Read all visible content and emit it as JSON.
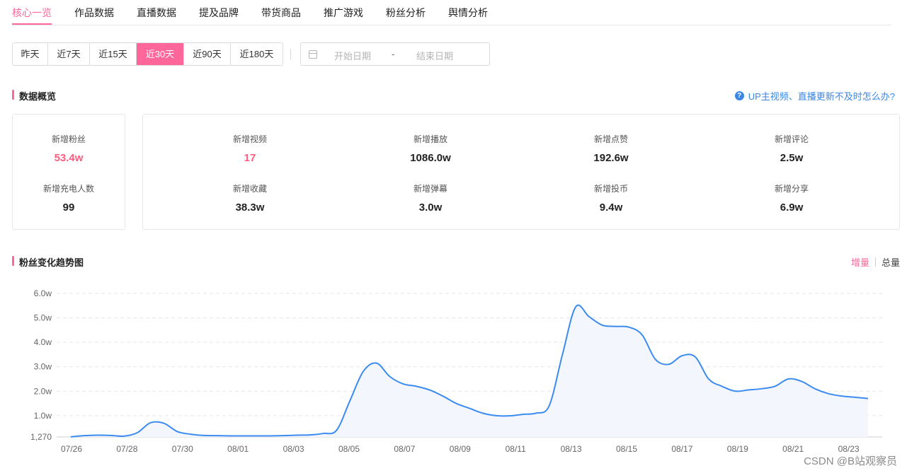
{
  "tabs": [
    {
      "label": "核心一览",
      "active": true
    },
    {
      "label": "作品数据"
    },
    {
      "label": "直播数据"
    },
    {
      "label": "提及品牌"
    },
    {
      "label": "带货商品"
    },
    {
      "label": "推广游戏"
    },
    {
      "label": "粉丝分析"
    },
    {
      "label": "舆情分析"
    }
  ],
  "periods": [
    {
      "label": "昨天"
    },
    {
      "label": "近7天"
    },
    {
      "label": "近15天"
    },
    {
      "label": "近30天",
      "active": true
    },
    {
      "label": "近90天"
    },
    {
      "label": "近180天"
    }
  ],
  "date_range": {
    "start_placeholder": "开始日期",
    "separator": "-",
    "end_placeholder": "结束日期"
  },
  "overview": {
    "title": "数据概览",
    "help": "UP主视频、直播更新不及时怎么办?",
    "fans": {
      "label": "新增粉丝",
      "value": "53.4w"
    },
    "charge": {
      "label": "新增充电人数",
      "value": "99"
    },
    "stats": [
      {
        "label": "新增视频",
        "value": "17"
      },
      {
        "label": "新增播放",
        "value": "1086.0w"
      },
      {
        "label": "新增点赞",
        "value": "192.6w"
      },
      {
        "label": "新增评论",
        "value": "2.5w"
      },
      {
        "label": "新增收藏",
        "value": "38.3w"
      },
      {
        "label": "新增弹幕",
        "value": "3.0w"
      },
      {
        "label": "新增投币",
        "value": "9.4w"
      },
      {
        "label": "新增分享",
        "value": "6.9w"
      }
    ]
  },
  "trend": {
    "title": "粉丝变化趋势图",
    "toggle_increment": "增量",
    "toggle_total": "总量"
  },
  "colors": {
    "accent": "#ff6699",
    "line": "#3b8bf0",
    "link": "#3a86e6"
  },
  "watermark": "CSDN @B站观察员",
  "chart_data": {
    "type": "area",
    "title": "",
    "xlabel": "",
    "ylabel": "",
    "ylim": [
      1270,
      60000
    ],
    "y_ticks": [
      {
        "label": "1,270",
        "value": 1270
      },
      {
        "label": "1.0w",
        "value": 10000
      },
      {
        "label": "2.0w",
        "value": 20000
      },
      {
        "label": "3.0w",
        "value": 30000
      },
      {
        "label": "4.0w",
        "value": 40000
      },
      {
        "label": "5.0w",
        "value": 50000
      },
      {
        "label": "6.0w",
        "value": 60000
      }
    ],
    "x_ticks": [
      "07/26",
      "07/28",
      "07/30",
      "08/01",
      "08/03",
      "08/05",
      "08/07",
      "08/09",
      "08/11",
      "08/13",
      "08/15",
      "08/17",
      "08/19",
      "08/21",
      "08/23"
    ],
    "series": [
      {
        "x": [
          0,
          0.5,
          1,
          1.5,
          2,
          2.5,
          3,
          3.5,
          4,
          4.5,
          5,
          5.5,
          6,
          6.5,
          7,
          7.5,
          8,
          8.5,
          9,
          9.5,
          10,
          10.5,
          11,
          11.5,
          12,
          12.5,
          13,
          13.5,
          14,
          14.5,
          15,
          15.5,
          16,
          16.5,
          17,
          17.5,
          18,
          18.5,
          19,
          19.5,
          20,
          20.5,
          21,
          21.5,
          22,
          22.5,
          23,
          23.5,
          24,
          24.5,
          25,
          25.5,
          26,
          26.5,
          27,
          27.5,
          28,
          28.5,
          29,
          29.5,
          30
        ],
        "values": [
          1300,
          1800,
          2000,
          1900,
          1600,
          3000,
          7100,
          6900,
          3500,
          2400,
          1900,
          1800,
          1700,
          1700,
          1700,
          1700,
          1800,
          2000,
          2100,
          2700,
          4000,
          16000,
          28000,
          31500,
          26000,
          23000,
          22000,
          20500,
          18000,
          15000,
          13000,
          11000,
          10000,
          9900,
          10500,
          11000,
          14000,
          35000,
          54500,
          50500,
          47000,
          46500,
          46200,
          43000,
          33000,
          31000,
          34500,
          34000,
          25000,
          22000,
          20000,
          20500,
          21000,
          22000,
          25000,
          24000,
          21000,
          19000,
          18000,
          17500,
          17000
        ]
      }
    ]
  }
}
